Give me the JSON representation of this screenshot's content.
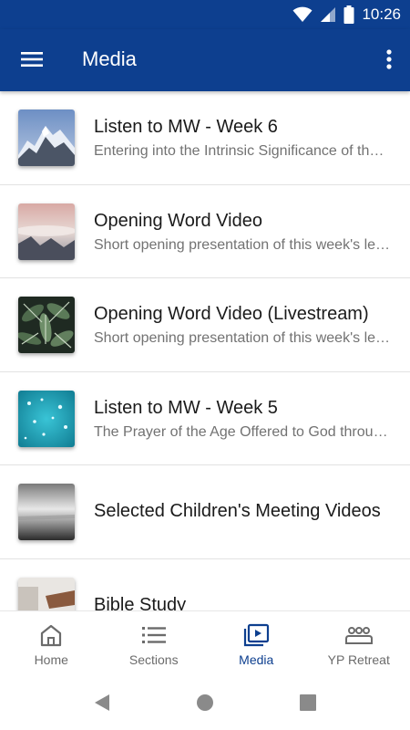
{
  "status_bar": {
    "time": "10:26"
  },
  "app_bar": {
    "title": "Media"
  },
  "media_items": [
    {
      "title": "Listen to MW - Week 6",
      "subtitle": "Entering into the Intrinsic Significance of the Tabernacle",
      "thumbnail": "mountain-peaks"
    },
    {
      "title": "Opening Word Video",
      "subtitle": "Short opening presentation of this week's lesson",
      "thumbnail": "misty-sky"
    },
    {
      "title": "Opening Word Video (Livestream)",
      "subtitle": "Short opening presentation of this week's lesson",
      "thumbnail": "green-leaves"
    },
    {
      "title": "Listen to MW - Week 5",
      "subtitle": "The Prayer of the Age Offered to God through Christ",
      "thumbnail": "water-drops"
    },
    {
      "title": "Selected Children's Meeting Videos",
      "subtitle": "",
      "thumbnail": "foggy-sea"
    },
    {
      "title": "Bible Study",
      "subtitle": "",
      "thumbnail": "book-hands"
    }
  ],
  "bottom_nav": [
    {
      "label": "Home",
      "icon": "home-icon",
      "active": false
    },
    {
      "label": "Sections",
      "icon": "list-icon",
      "active": false
    },
    {
      "label": "Media",
      "icon": "video-library-icon",
      "active": true
    },
    {
      "label": "YP Retreat",
      "icon": "group-icon",
      "active": false
    }
  ],
  "colors": {
    "primary": "#0d3f8f",
    "inactive": "#6b6b6b",
    "divider": "#e2e2e2"
  }
}
